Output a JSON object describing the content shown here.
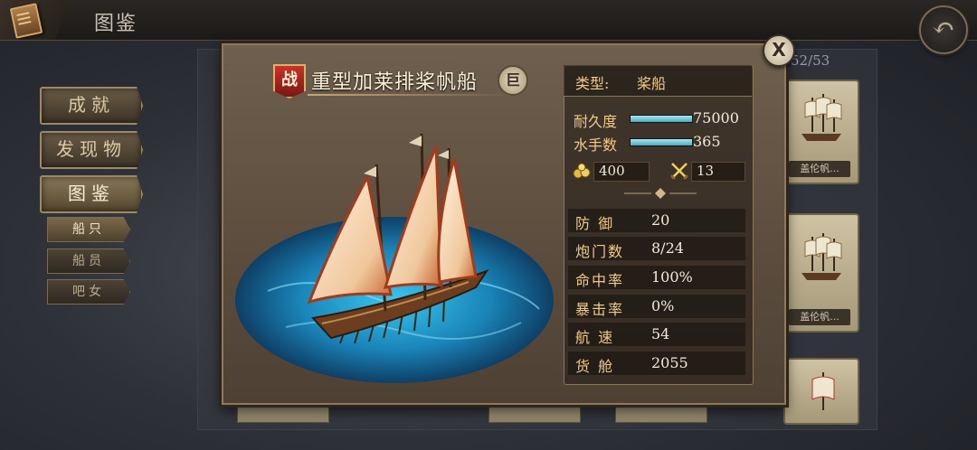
{
  "header": {
    "title": "图鉴",
    "back_icon": "back-arrow-icon",
    "book_icon": "book-icon"
  },
  "menu": {
    "items": [
      {
        "label": "成就",
        "active": false
      },
      {
        "label": "发现物",
        "active": false
      },
      {
        "label": "图鉴",
        "active": true
      }
    ],
    "sub_items": [
      {
        "label": "船只",
        "active": true
      },
      {
        "label": "船员",
        "active": false
      },
      {
        "label": "吧女",
        "active": false
      }
    ]
  },
  "collection": {
    "count": "52/53",
    "visible_captions": [
      "盖伦帆...",
      "盖伦帆..."
    ]
  },
  "ship": {
    "badge": "战",
    "name": "重型加莱排桨帆船",
    "size_badge": "巨",
    "type_label": "类型:",
    "type_value": "桨船",
    "durability_label": "耐久度",
    "durability_value": "75000",
    "durability_fill": 1.0,
    "sailors_label": "水手数",
    "sailors_value": "365",
    "sailors_fill": 1.0,
    "cannonballs": "400",
    "swords": "13",
    "stats": [
      {
        "label": "防 御",
        "value": "20"
      },
      {
        "label": "炮门数",
        "value": "8/24"
      },
      {
        "label": "命中率",
        "value": "100%"
      },
      {
        "label": "暴击率",
        "value": "0%"
      },
      {
        "label": "航 速",
        "value": "54"
      },
      {
        "label": "货 舱",
        "value": "2055"
      }
    ]
  },
  "close_icon": "close-x-icon",
  "colors": {
    "accent_gold": "#f0c98a",
    "bar_teal": "#4fa9be",
    "badge_red": "#c9322a"
  }
}
